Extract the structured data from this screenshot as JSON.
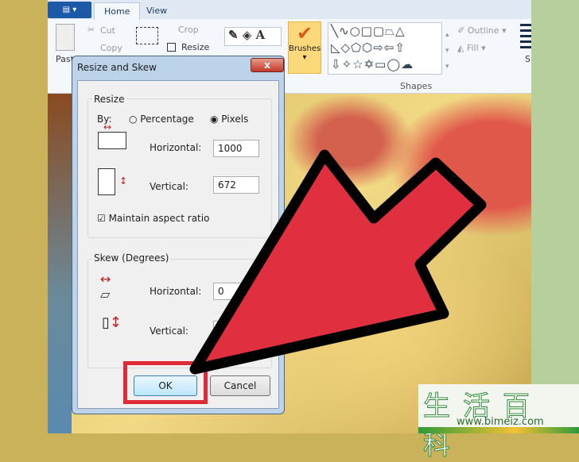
{
  "ribbon": {
    "tabs": [
      "Home",
      "View"
    ],
    "paste": "Paste",
    "cut": "Cut",
    "copy": "Copy",
    "crop": "Crop",
    "resize": "Resize",
    "brushes": "Brushes",
    "outline": "Outline",
    "fill": "Fill",
    "shapes_label": "Shapes",
    "size": "S"
  },
  "dialog": {
    "title": "Resize and Skew",
    "close": "x",
    "resize": {
      "heading": "Resize",
      "by": "By:",
      "percentage": "Percentage",
      "pixels": "Pixels",
      "selected": "Pixels",
      "horizontal_label": "Horizontal:",
      "horizontal_value": "1000",
      "vertical_label": "Vertical:",
      "vertical_value": "672",
      "maintain": "Maintain aspect ratio",
      "maintain_checked": true
    },
    "skew": {
      "heading": "Skew (Degrees)",
      "horizontal_label": "Horizontal:",
      "horizontal_value": "0",
      "vertical_label": "Vertical:",
      "vertical_value": ""
    },
    "ok": "OK",
    "cancel": "Cancel"
  },
  "annotation": {
    "arrow_color": "#e0303f",
    "highlight_color": "#e02a3a"
  },
  "watermark": {
    "chinese": "生活百科",
    "url": "www.bimeiz.com"
  }
}
